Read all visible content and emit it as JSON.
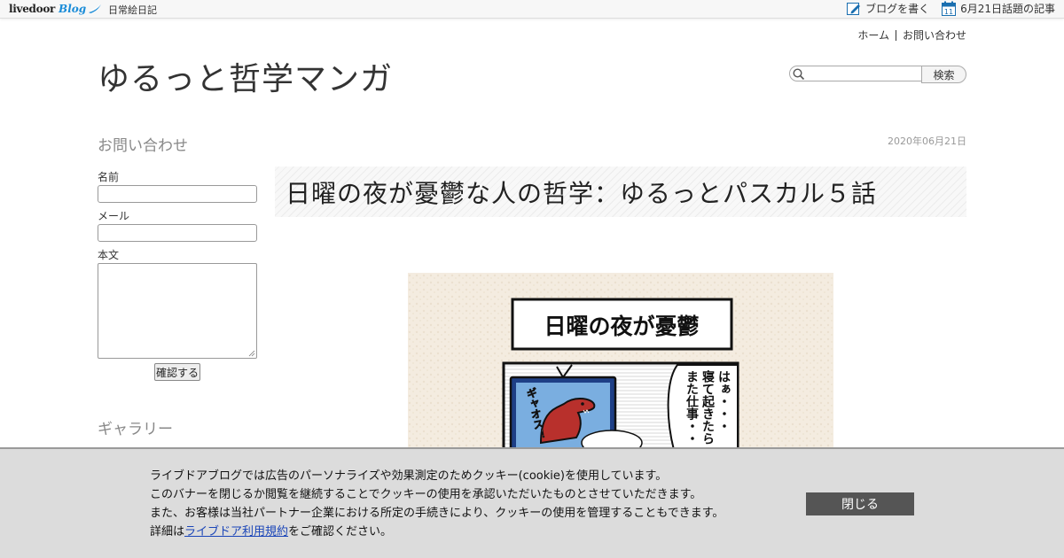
{
  "topbar": {
    "brand_livedoor": "livedoor",
    "brand_blog": "Blog",
    "category": "日常絵日記",
    "write_blog": "ブログを書く",
    "calendar_day": "11",
    "topic_articles": "6月21日話題の記事"
  },
  "header": {
    "nav": [
      "ホーム",
      "お問い合わせ"
    ],
    "site_title": "ゆるっと哲学マンガ",
    "search_placeholder": "",
    "search_button": "検索"
  },
  "sidebar": {
    "contact_heading": "お問い合わせ",
    "name_label": "名前",
    "mail_label": "メール",
    "body_label": "本文",
    "confirm_button": "確認する",
    "gallery_heading": "ギャラリー"
  },
  "article": {
    "date": "2020年06月21日",
    "title": "日曜の夜が憂鬱な人の哲学：ゆるっとパスカル５話",
    "manga": {
      "panel_title": "日曜の夜が憂鬱",
      "sfx": "ギャオス！",
      "speech": [
        "はぁ・・・",
        "寝て起きたら",
        "また仕事・・・"
      ]
    }
  },
  "cookie_banner": {
    "line1": "ライブドアブログでは広告のパーソナライズや効果測定のためクッキー(cookie)を使用しています。",
    "line2": "このバナーを閉じるか閲覧を継続することでクッキーの使用を承認いただいたものとさせていただきます。",
    "line3": "また、お客様は当社パートナー企業における所定の手続きにより、クッキーの使用を管理することもできます。",
    "line4_prefix": "詳細は",
    "line4_link": "ライブドア利用規約",
    "line4_suffix": "をご確認ください。",
    "close_button": "閉じる"
  }
}
